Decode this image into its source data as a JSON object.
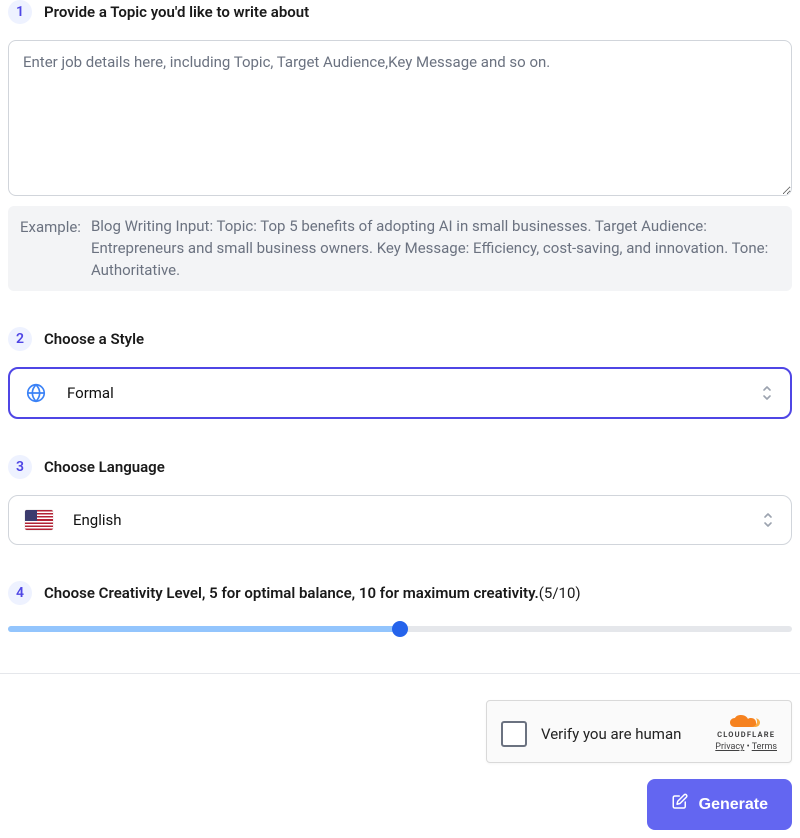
{
  "step1": {
    "number": "1",
    "title": "Provide a Topic you'd like to write about",
    "placeholder": "Enter job details here, including Topic, Target Audience,Key Message and so on.",
    "value": "",
    "example_label": "Example:",
    "example_text": "Blog Writing Input: Topic: Top 5 benefits of adopting AI in small businesses. Target Audience: Entrepreneurs and small business owners. Key Message: Efficiency, cost-saving, and innovation. Tone: Authoritative."
  },
  "step2": {
    "number": "2",
    "title": "Choose a Style",
    "selected": "Formal",
    "icon": "globe-icon"
  },
  "step3": {
    "number": "3",
    "title": "Choose Language",
    "selected": "English",
    "icon": "flag-us"
  },
  "step4": {
    "number": "4",
    "title_prefix": "Choose Creativity Level, 5 for optimal balance, 10 for maximum creativity.",
    "value": 5,
    "max": 10,
    "display": "(5/10)"
  },
  "captcha": {
    "label": "Verify you are human",
    "brand": "CLOUDFLARE",
    "privacy": "Privacy",
    "terms": "Terms"
  },
  "generate_label": "Generate"
}
